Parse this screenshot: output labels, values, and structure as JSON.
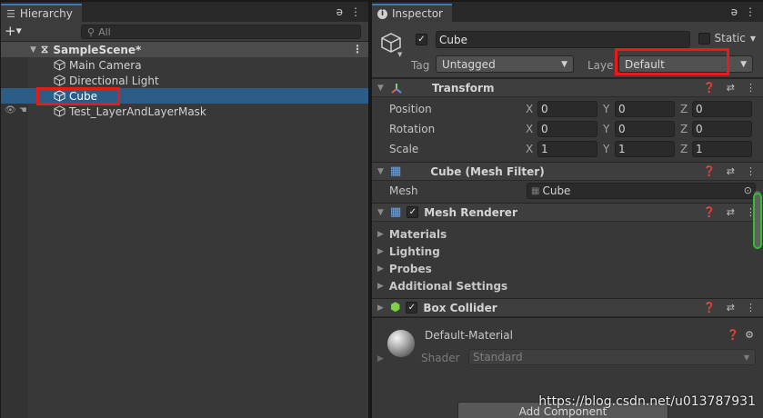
{
  "hierarchy": {
    "tab_label": "Hierarchy",
    "add_label": "+",
    "search_placeholder": "All",
    "scene_name": "SampleScene*",
    "items": [
      {
        "label": "Main Camera"
      },
      {
        "label": "Directional Light"
      },
      {
        "label": "Cube",
        "selected": true
      },
      {
        "label": "Test_LayerAndLayerMask"
      }
    ]
  },
  "inspector": {
    "tab_label": "Inspector",
    "object_name": "Cube",
    "static_label": "Static",
    "tag_label": "Tag",
    "tag_value": "Untagged",
    "layer_label": "Laye",
    "layer_value": "Default",
    "transform": {
      "title": "Transform",
      "rows": [
        {
          "label": "Position",
          "x": "0",
          "y": "0",
          "z": "0"
        },
        {
          "label": "Rotation",
          "x": "0",
          "y": "0",
          "z": "0"
        },
        {
          "label": "Scale",
          "x": "1",
          "y": "1",
          "z": "1"
        }
      ]
    },
    "mesh_filter": {
      "title": "Cube (Mesh Filter)",
      "mesh_label": "Mesh",
      "mesh_value": "Cube"
    },
    "mesh_renderer": {
      "title": "Mesh Renderer",
      "sections": [
        "Materials",
        "Lighting",
        "Probes",
        "Additional Settings"
      ]
    },
    "box_collider": {
      "title": "Box Collider"
    },
    "material": {
      "name": "Default-Material",
      "shader_label": "Shader",
      "shader_value": "Standard"
    },
    "add_component_label": "Add Component"
  },
  "watermark": "https://blog.csdn.net/u013787931",
  "colors": {
    "selection": "#2c5d87",
    "highlight_box": "#e81a1a",
    "tab_accent": "#3a79bb"
  }
}
